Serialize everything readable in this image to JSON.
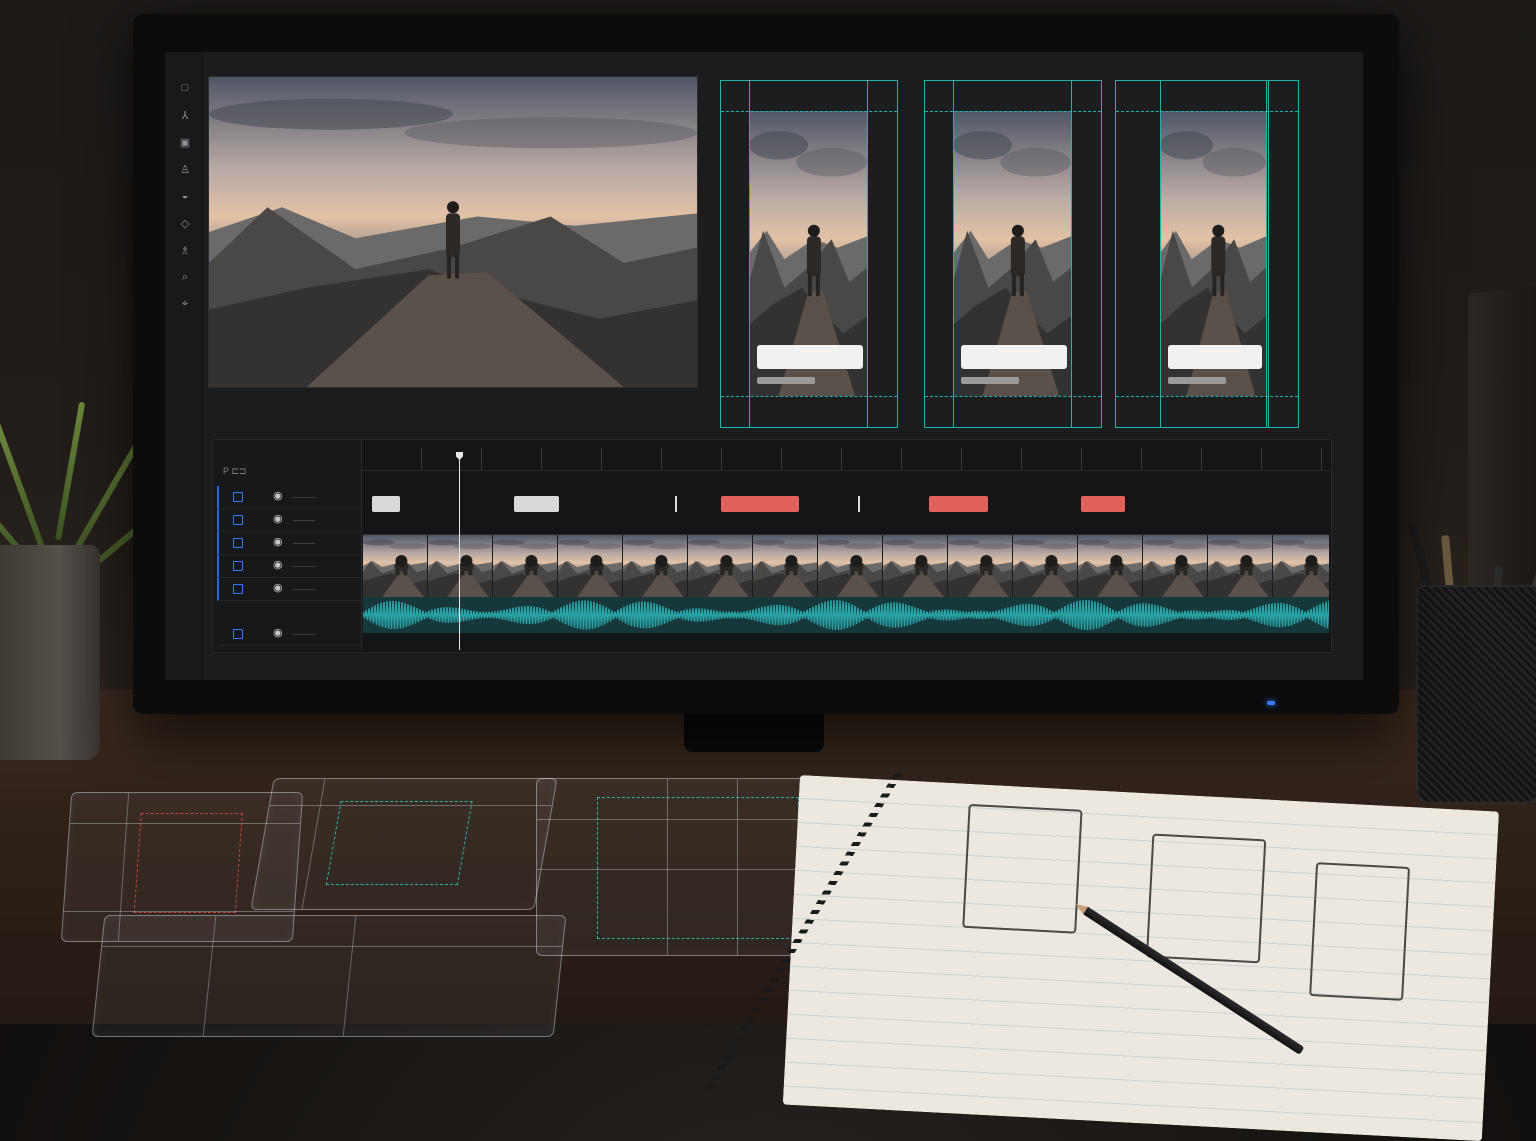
{
  "scene": {
    "description_free": true
  },
  "toolbar": {
    "tools": [
      {
        "name": "select-tool-icon",
        "glyph": "□"
      },
      {
        "name": "pen-tool-icon",
        "glyph": "⅄"
      },
      {
        "name": "image-tool-icon",
        "glyph": "▣"
      },
      {
        "name": "stamp-tool-icon",
        "glyph": "♙"
      },
      {
        "name": "fill-tool-icon",
        "glyph": "◒"
      },
      {
        "name": "shape-tool-icon",
        "glyph": "◇"
      },
      {
        "name": "person-tool-icon",
        "glyph": "♗"
      },
      {
        "name": "zoom-tool-icon",
        "glyph": "⌕"
      },
      {
        "name": "hand-tool-icon",
        "glyph": "⌖"
      }
    ]
  },
  "timeline": {
    "header_label": "P ⊏⊐",
    "row_count": 6,
    "playhead_position": 0.1
  },
  "colors": {
    "accent_teal": "#1fb5ad",
    "clip_red": "#e0605a",
    "clip_white": "#d9d9d9",
    "track_blue": "#1e6bd8",
    "waveform": "#2aa3a6"
  }
}
